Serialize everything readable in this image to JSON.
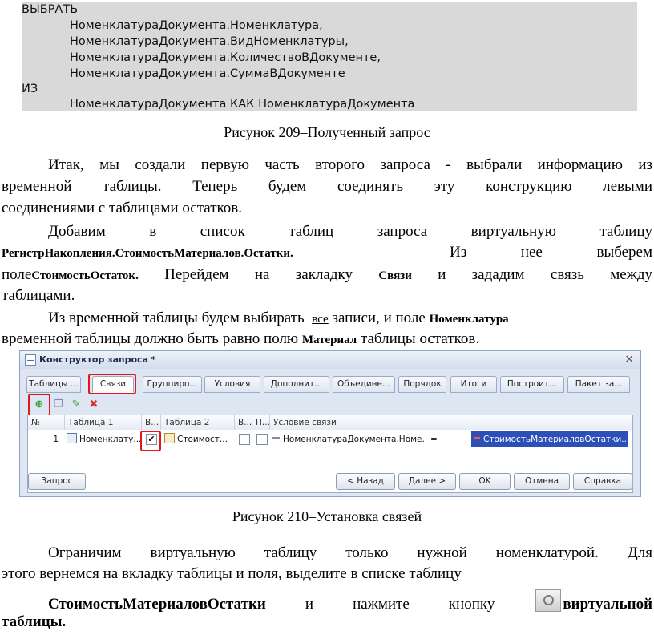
{
  "code": {
    "lines": [
      "ВЫБРАТЬ",
      "НоменклатураДокумента.Номенклатура,",
      "НоменклатураДокумента.ВидНоменклатуры,",
      "НоменклатураДокумента.КоличествоВДокументе,",
      "НоменклатураДокумента.СуммаВДокументе",
      "ИЗ",
      "НоменклатураДокумента КАК НоменклатураДокумента"
    ]
  },
  "caption1": "Рисунок 209–Полученный запрос",
  "para1": {
    "l1": "Итак, мы создали первую часть второго запроса - выбрали информацию из",
    "l2": "временной таблицы. Теперь будем соединять эту конструкцию левыми",
    "l3": "соединениями с таблицами остатков."
  },
  "para2": {
    "l1": "Добавим в список таблиц запроса виртуальную таблицу",
    "t1": "РегистрНакопления.СтоимостьМатериалов.Остатки.",
    "t2": "Из нее выберем",
    "t3": "поле",
    "t4": "СтоимостьОстаток.",
    "t5": "Перейдем на закладку",
    "t6": "Связи",
    "t7": "и зададим связь между",
    "l4": "таблицами."
  },
  "para3": {
    "a": "Из временной таблицы будем выбирать",
    "b": "все",
    "c": "записи, и поле",
    "d": "Номенклатура",
    "e": "временной таблицы должно быть равно полю",
    "f": "Материал",
    "g": "таблицы остатков."
  },
  "window": {
    "title": "Конструктор запроса *",
    "tabs": [
      "Таблицы ...",
      "Связи",
      "Группиро...",
      "Условия",
      "Дополнит...",
      "Объедине...",
      "Порядок",
      "Итоги",
      "Построит...",
      "Пакет за..."
    ],
    "columns": [
      "№",
      "Таблица 1",
      "В...",
      "Таблица 2",
      "В...",
      "П...",
      "Условие связи"
    ],
    "row": {
      "num": "1",
      "table1": "Номенклату...",
      "table2": "Стоимост...",
      "condition_left": "НоменклатураДокумента.Номе...",
      "operator": "=",
      "condition_right": "СтоимостьМатериаловОстатки...."
    },
    "buttons": {
      "query": "Запрос",
      "back": "< Назад",
      "next": "Далее >",
      "ok": "OK",
      "cancel": "Отмена",
      "help": "Справка"
    }
  },
  "caption2": "Рисунок 210–Установка связей",
  "para4": {
    "l1": "Ограничим виртуальную таблицу только нужной номенклатурой. Для",
    "l2": "этого вернемся на вкладку таблицы и поля, выделите в списке таблицу",
    "b1": "СтоимостьМатериаловОстатки",
    "t1": "и нажмите кнопку",
    "b2": "виртуальной",
    "b3": "таблицы."
  },
  "colors": {
    "highlight": "#2c50b8",
    "red_box": "#e01818",
    "window_bg": "#dde6f2"
  }
}
